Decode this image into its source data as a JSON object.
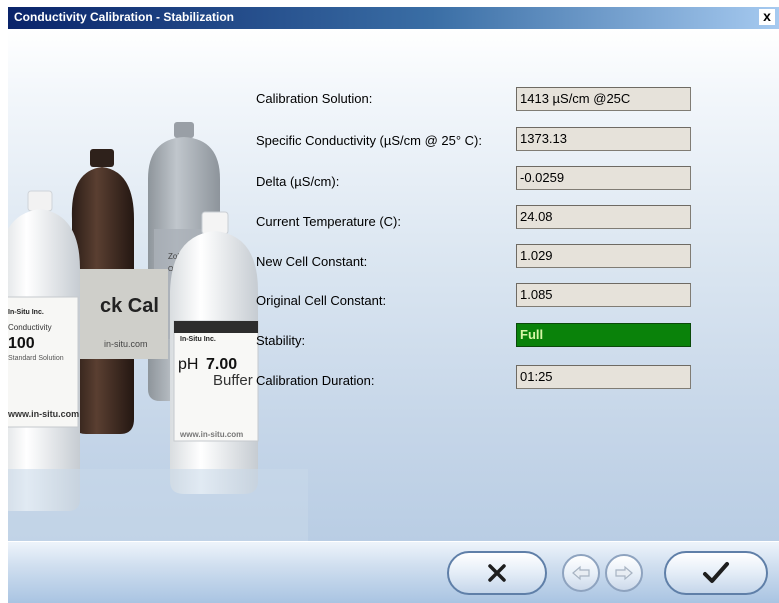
{
  "window": {
    "title": "Conductivity Calibration - Stabilization",
    "close_label": "x"
  },
  "photo": {
    "bottle1": {
      "brand": "In-Situ Inc.",
      "line1": "Conductivity",
      "line2": "100",
      "line3": "Standard Solution",
      "url": "www.in-situ.com"
    },
    "bottle2": {
      "text": "ck Cal",
      "brand": "in-situ.com"
    },
    "bottle3": {
      "text": "Zobell",
      "text2": "ORP S"
    },
    "bottle4": {
      "brand": "In-Situ Inc.",
      "ph": "pH",
      "value": "7.00",
      "word": "Buffer",
      "url": "www.in-situ.com"
    }
  },
  "fields": [
    {
      "label": "Calibration Solution:",
      "value": "1413 µS/cm @25C"
    },
    {
      "label": "Specific Conductivity (µS/cm @ 25° C):",
      "value": "1373.13"
    },
    {
      "label": "Delta (µS/cm):",
      "value": "-0.0259"
    },
    {
      "label": "Current Temperature (C):",
      "value": "24.08"
    },
    {
      "label": "New Cell Constant:",
      "value": "1.029"
    },
    {
      "label": "Original Cell Constant:",
      "value": "1.085"
    },
    {
      "label": "Stability:",
      "value": "Full"
    },
    {
      "label": "Calibration Duration:",
      "value": "01:25"
    }
  ],
  "colors": {
    "stability_ok": "#0a820a",
    "title_bar": "#0a246a"
  },
  "buttons": {
    "cancel_icon": "x-icon",
    "back_icon": "arrow-left-icon",
    "next_icon": "arrow-right-icon",
    "finish_icon": "checkmark-icon"
  }
}
